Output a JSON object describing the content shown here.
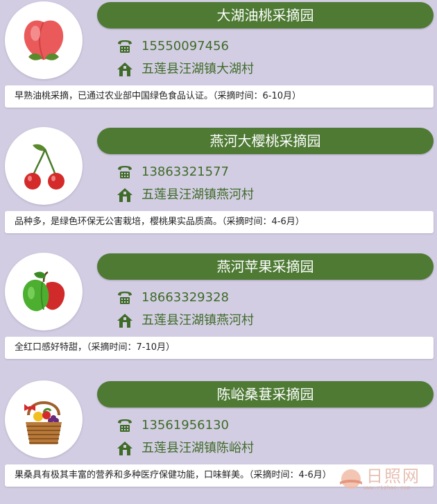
{
  "colors": {
    "background": "#d3cde4",
    "title_bar": "#4e7a34",
    "info_text": "#3e6b26"
  },
  "orchards": [
    {
      "icon": "peach-icon",
      "name": "大湖油桃采摘园",
      "phone": "15550097456",
      "address": "五莲县汪湖镇大湖村",
      "description": "早熟油桃采摘，已通过农业部中国绿色食品认证。（采摘时间：6-10月）"
    },
    {
      "icon": "cherry-icon",
      "name": "燕河大樱桃采摘园",
      "phone": "13863321577",
      "address": "五莲县汪湖镇燕河村",
      "description": "品种多，是绿色环保无公害栽培，樱桃果实品质高。（采摘时间：4-6月）"
    },
    {
      "icon": "apple-icon",
      "name": "燕河苹果采摘园",
      "phone": "18663329328",
      "address": "五莲县汪湖镇燕河村",
      "description": "全红口感好特甜，（采摘时间：7-10月）"
    },
    {
      "icon": "fruit-basket-icon",
      "name": "陈峪桑葚采摘园",
      "phone": "13561956130",
      "address": "五莲县汪湖镇陈峪村",
      "description": "果桑具有极其丰富的营养和多种医疗保健功能，口味鲜美。（采摘时间：4-6月）"
    }
  ],
  "watermark": {
    "text": "日照网",
    "url": "www.rizhao.com"
  }
}
